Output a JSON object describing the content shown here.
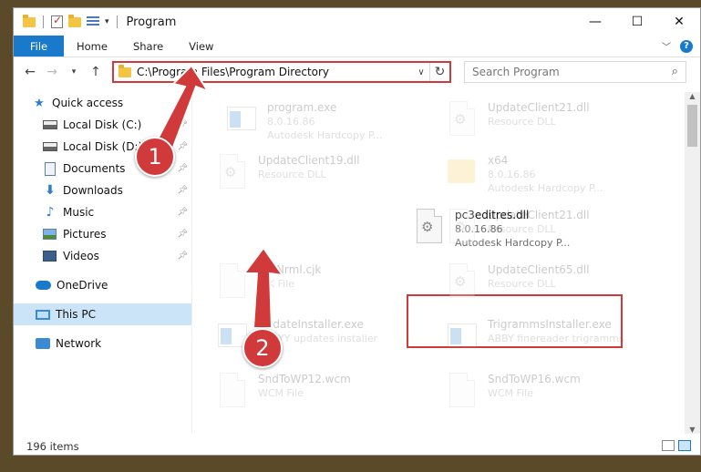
{
  "window": {
    "title": "Program"
  },
  "ribbon": {
    "tabs": [
      "File",
      "Home",
      "Share",
      "View"
    ]
  },
  "address": {
    "path": "C:\\Program Files\\Program Directory"
  },
  "search": {
    "placeholder": "Search Program"
  },
  "sidebar": {
    "items": [
      {
        "label": "Quick access",
        "icon": "star-icon",
        "pinned": false
      },
      {
        "label": "Local Disk (C:)",
        "icon": "disk-icon",
        "pinned": true
      },
      {
        "label": "Local Disk (D:)",
        "icon": "disk-icon",
        "pinned": true
      },
      {
        "label": "Documents",
        "icon": "documents-icon",
        "pinned": true
      },
      {
        "label": "Downloads",
        "icon": "download-icon",
        "pinned": true
      },
      {
        "label": "Music",
        "icon": "music-icon",
        "pinned": true
      },
      {
        "label": "Pictures",
        "icon": "pictures-icon",
        "pinned": true
      },
      {
        "label": "Videos",
        "icon": "videos-icon",
        "pinned": true
      },
      {
        "label": "OneDrive",
        "icon": "cloud-icon"
      },
      {
        "label": "This PC",
        "icon": "pc-icon",
        "selected": true
      },
      {
        "label": "Network",
        "icon": "network-icon"
      }
    ]
  },
  "files": [
    {
      "name": "program.exe",
      "line1": "8.0.16.86",
      "line2": "Autodesk Hardcopy P..."
    },
    {
      "name": "UpdateClient21.dll",
      "line1": "Resource DLL"
    },
    {
      "name": "UpdateClient19.dll",
      "line1": "Resource DLL"
    },
    {
      "name": "x64",
      "line1": "8.0.16.86",
      "line2": "Autodesk Hardcopy P..."
    },
    {
      "name": "pc3editres.dll",
      "line1": "8.0.16.86",
      "line2": "Autodesk Hardcopy P..."
    },
    {
      "name": "UpdateClient21.dll",
      "line1": "Resource DLL"
    },
    {
      "name": "SntNrml.cjk",
      "line1": "CJK File"
    },
    {
      "name": "UpdateClient65.dll",
      "line1": "Resource DLL"
    },
    {
      "name": "UpdateInstaller.exe",
      "line1": "ABBYY updates installer"
    },
    {
      "name": "TrigrammsInstaller.exe",
      "line1": "ABBY finereader trigramms"
    },
    {
      "name": "SndToWP12.wcm",
      "line1": "WCM File"
    },
    {
      "name": "SndToWP16.wcm",
      "line1": "WCM File"
    }
  ],
  "status": {
    "count": "196 items"
  },
  "annotations": {
    "step1": "1",
    "step2": "2"
  },
  "colors": {
    "highlight": "#d03a3a",
    "accent": "#1979ca"
  }
}
